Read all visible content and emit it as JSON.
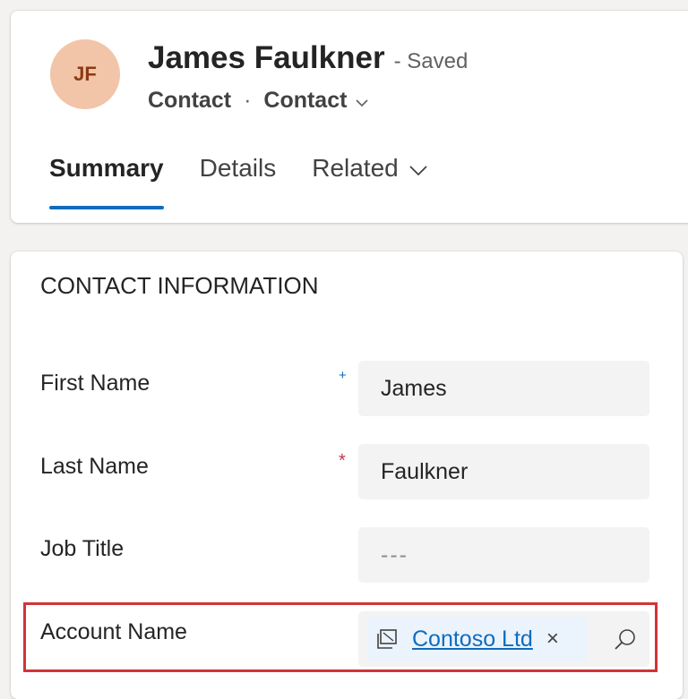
{
  "record": {
    "initials": "JF",
    "name": "James Faulkner",
    "save_status": "- Saved",
    "entity": "Contact",
    "separator": "·",
    "form_name": "Contact"
  },
  "tabs": [
    {
      "label": "Summary",
      "active": true
    },
    {
      "label": "Details",
      "active": false
    },
    {
      "label": "Related",
      "active": false
    }
  ],
  "section": {
    "title": "CONTACT INFORMATION",
    "fields": [
      {
        "label": "First Name",
        "requirement": "+",
        "value": "James"
      },
      {
        "label": "Last Name",
        "requirement": "*",
        "value": "Faulkner"
      },
      {
        "label": "Job Title",
        "value": "---"
      },
      {
        "label": "Account Name",
        "lookup_value": "Contoso Ltd",
        "remove_glyph": "×"
      }
    ]
  },
  "colors": {
    "accent": "#0f6cbd",
    "highlight": "#d13438",
    "avatar_bg": "#f2c4a8",
    "required": "#c4314b"
  },
  "icons": [
    "chevron-down-icon",
    "account-entity-icon",
    "close-icon",
    "search-icon"
  ]
}
